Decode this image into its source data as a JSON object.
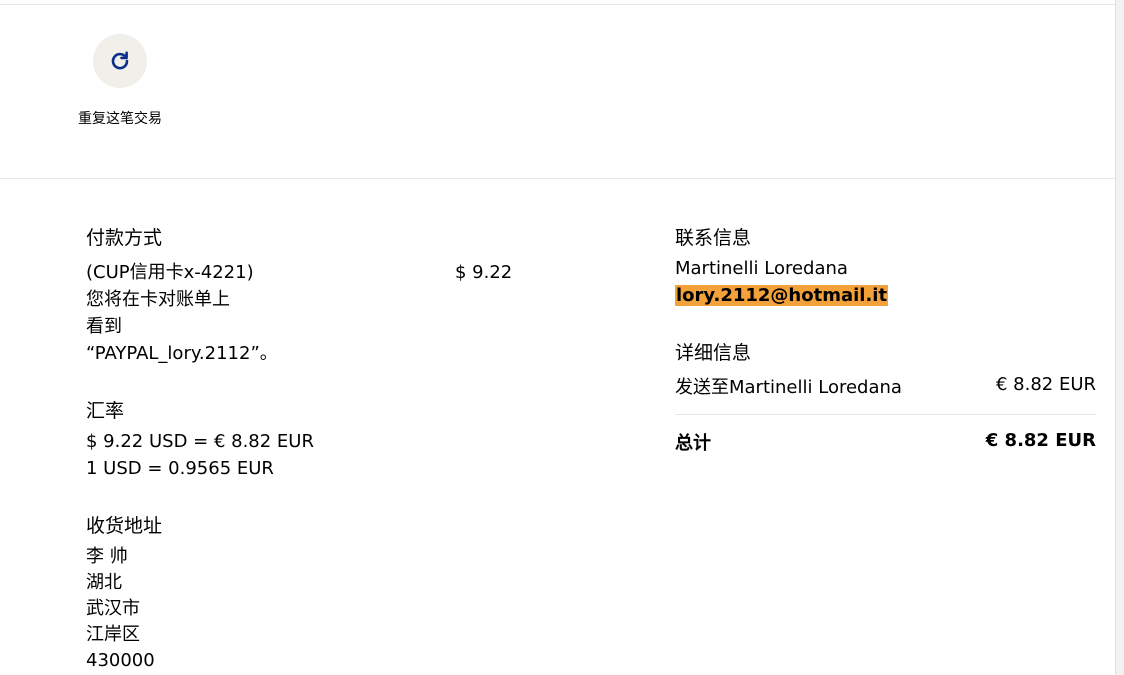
{
  "actions": {
    "repeat_transaction": {
      "label": "重复这笔交易",
      "icon": "refresh-icon"
    }
  },
  "payment_method": {
    "title": "付款方式",
    "lines": [
      "(CUP信用卡x-4221)",
      "您将在卡对账单上",
      "看到",
      "“PAYPAL_lory.2112”。"
    ],
    "amount": "$ 9.22"
  },
  "exchange_rate": {
    "title": "汇率",
    "lines": [
      "$ 9.22 USD = € 8.82 EUR",
      "1 USD = 0.9565 EUR"
    ]
  },
  "shipping_address": {
    "title": "收货地址",
    "lines": [
      "李 帅",
      "湖北",
      "武汉市",
      "江岸区",
      "430000"
    ]
  },
  "contact_info": {
    "title": "联系信息",
    "name": "Martinelli Loredana",
    "email": "lory.2112@hotmail.it"
  },
  "details": {
    "title": "详细信息",
    "sent_to_label": "发送至Martinelli Loredana",
    "sent_to_amount": "€ 8.82 EUR",
    "total_label": "总计",
    "total_amount": "€ 8.82 EUR"
  },
  "colors": {
    "accent_circle": "#f1efea",
    "icon_blue": "#0b2e8a",
    "highlight_orange": "#f3a13a"
  }
}
